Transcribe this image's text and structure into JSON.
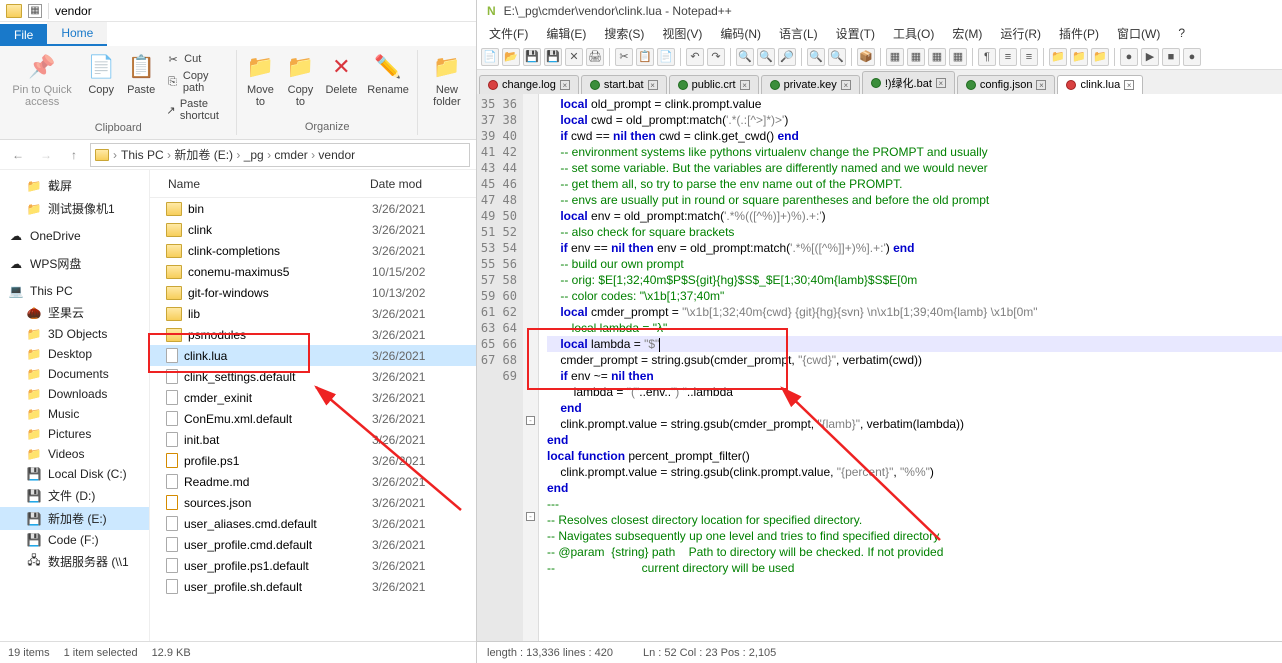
{
  "explorer": {
    "titlebar_path": "vendor",
    "tabs": {
      "file": "File",
      "home": "Home"
    },
    "ribbon": {
      "pin": "Pin to Quick access",
      "copy": "Copy",
      "paste": "Paste",
      "cut": "Cut",
      "copy_path": "Copy path",
      "paste_shortcut": "Paste shortcut",
      "group_clipboard": "Clipboard",
      "move_to": "Move to",
      "copy_to": "Copy to",
      "delete": "Delete",
      "rename": "Rename",
      "group_organize": "Organize",
      "new_folder": "New folder"
    },
    "breadcrumb": [
      "This PC",
      "新加卷 (E:)",
      "_pg",
      "cmder",
      "vendor"
    ],
    "tree": [
      {
        "label": "截屏",
        "kind": "folder",
        "child": true
      },
      {
        "label": "测试摄像机1",
        "kind": "folder",
        "child": true
      },
      {
        "label": "OneDrive",
        "kind": "cloud"
      },
      {
        "label": "WPS网盘",
        "kind": "cloud"
      },
      {
        "label": "This PC",
        "kind": "pc",
        "expanded": true
      },
      {
        "label": "坚果云",
        "kind": "nut",
        "child": true
      },
      {
        "label": "3D Objects",
        "kind": "sys",
        "child": true
      },
      {
        "label": "Desktop",
        "kind": "sys",
        "child": true
      },
      {
        "label": "Documents",
        "kind": "sys",
        "child": true
      },
      {
        "label": "Downloads",
        "kind": "sys",
        "child": true
      },
      {
        "label": "Music",
        "kind": "sys",
        "child": true
      },
      {
        "label": "Pictures",
        "kind": "sys",
        "child": true
      },
      {
        "label": "Videos",
        "kind": "sys",
        "child": true
      },
      {
        "label": "Local Disk (C:)",
        "kind": "drive",
        "child": true
      },
      {
        "label": "文件 (D:)",
        "kind": "drive",
        "child": true
      },
      {
        "label": "新加卷 (E:)",
        "kind": "drive",
        "child": true,
        "selected": true
      },
      {
        "label": "Code (F:)",
        "kind": "drive",
        "child": true
      },
      {
        "label": "数据服务器 (\\\\1",
        "kind": "net",
        "child": true
      }
    ],
    "cols": {
      "name": "Name",
      "date": "Date mod"
    },
    "files": [
      {
        "name": "bin",
        "date": "3/26/2021",
        "kind": "folder"
      },
      {
        "name": "clink",
        "date": "3/26/2021",
        "kind": "folder"
      },
      {
        "name": "clink-completions",
        "date": "3/26/2021",
        "kind": "folder"
      },
      {
        "name": "conemu-maximus5",
        "date": "10/15/202",
        "kind": "folder"
      },
      {
        "name": "git-for-windows",
        "date": "10/13/202",
        "kind": "folder"
      },
      {
        "name": "lib",
        "date": "3/26/2021",
        "kind": "folder"
      },
      {
        "name": "psmodules",
        "date": "3/26/2021",
        "kind": "folder"
      },
      {
        "name": "clink.lua",
        "date": "3/26/2021",
        "kind": "file",
        "selected": true
      },
      {
        "name": "clink_settings.default",
        "date": "3/26/2021",
        "kind": "file"
      },
      {
        "name": "cmder_exinit",
        "date": "3/26/2021",
        "kind": "file"
      },
      {
        "name": "ConEmu.xml.default",
        "date": "3/26/2021",
        "kind": "file"
      },
      {
        "name": "init.bat",
        "date": "3/26/2021",
        "kind": "file"
      },
      {
        "name": "profile.ps1",
        "date": "3/26/2021",
        "kind": "js"
      },
      {
        "name": "Readme.md",
        "date": "3/26/2021",
        "kind": "file"
      },
      {
        "name": "sources.json",
        "date": "3/26/2021",
        "kind": "js"
      },
      {
        "name": "user_aliases.cmd.default",
        "date": "3/26/2021",
        "kind": "file"
      },
      {
        "name": "user_profile.cmd.default",
        "date": "3/26/2021",
        "kind": "file"
      },
      {
        "name": "user_profile.ps1.default",
        "date": "3/26/2021",
        "kind": "file"
      },
      {
        "name": "user_profile.sh.default",
        "date": "3/26/2021",
        "kind": "file"
      }
    ],
    "status": {
      "count": "19 items",
      "selected": "1 item selected",
      "size": "12.9 KB"
    }
  },
  "npp": {
    "title": "E:\\_pg\\cmder\\vendor\\clink.lua - Notepad++",
    "menu": [
      "文件(F)",
      "编辑(E)",
      "搜索(S)",
      "视图(V)",
      "编码(N)",
      "语言(L)",
      "设置(T)",
      "工具(O)",
      "宏(M)",
      "运行(R)",
      "插件(P)",
      "窗口(W)",
      "?"
    ],
    "tabs": [
      {
        "name": "change.log",
        "mod": true
      },
      {
        "name": "start.bat",
        "mod": false
      },
      {
        "name": "public.crt",
        "mod": false
      },
      {
        "name": "private.key",
        "mod": false
      },
      {
        "name": "!)绿化.bat",
        "mod": false
      },
      {
        "name": "config.json",
        "mod": false
      },
      {
        "name": "clink.lua",
        "mod": true,
        "active": true
      }
    ],
    "lines_start": 35,
    "code": [
      "    local old_prompt = clink.prompt.value",
      "    local cwd = old_prompt:match('.*(.:[^>]*)>')",
      "    if cwd == nil then cwd = clink.get_cwd() end",
      "",
      "    -- environment systems like pythons virtualenv change the PROMPT and usually",
      "    -- set some variable. But the variables are differently named and we would never",
      "    -- get them all, so try to parse the env name out of the PROMPT.",
      "    -- envs are usually put in round or square parentheses and before the old prompt",
      "    local env = old_prompt:match('.*%(([^%)]+)%).+:')",
      "    -- also check for square brackets",
      "    if env == nil then env = old_prompt:match('.*%[([^%]]+)%].+:') end",
      "",
      "    -- build our own prompt",
      "    -- orig: $E[1;32;40m$P$S{git}{hg}$S$_$E[1;30;40m{lamb}$S$E[0m",
      "    -- color codes: \"\\x1b[1;37;40m\"",
      "    local cmder_prompt = \"\\x1b[1;32;40m{cwd} {git}{hg}{svn} \\n\\x1b[1;39;40m{lamb} \\x1b[0m\"",
      "    -- local lambda = \"λ\"",
      "    local lambda = \"$\"",
      "    cmder_prompt = string.gsub(cmder_prompt, \"{cwd}\", verbatim(cwd))",
      "",
      "    if env ~= nil then",
      "        lambda = \"(\"..env..\") \"..lambda",
      "    end",
      "    clink.prompt.value = string.gsub(cmder_prompt, \"{lamb}\", verbatim(lambda))",
      "end",
      "",
      "local function percent_prompt_filter()",
      "    clink.prompt.value = string.gsub(clink.prompt.value, \"{percent}\", \"%%\")",
      "end",
      "",
      "---",
      "-- Resolves closest directory location for specified directory.",
      "-- Navigates subsequently up one level and tries to find specified directory",
      "-- @param  {string} path    Path to directory will be checked. If not provided",
      "--                          current directory will be used"
    ],
    "status": {
      "length": "length : 13,336   lines : 420",
      "pos": "Ln : 52    Col : 23    Pos : 2,105"
    }
  }
}
